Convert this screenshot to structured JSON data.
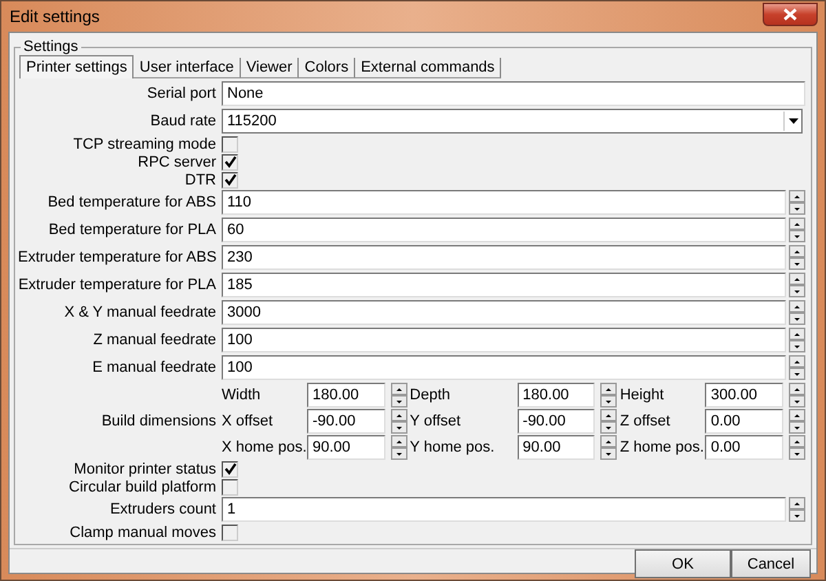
{
  "window": {
    "title": "Edit settings"
  },
  "group": {
    "title": "Settings"
  },
  "tabs": [
    {
      "label": "Printer settings",
      "selected": true
    },
    {
      "label": "User interface",
      "selected": false
    },
    {
      "label": "Viewer",
      "selected": false
    },
    {
      "label": "Colors",
      "selected": false
    },
    {
      "label": "External commands",
      "selected": false
    }
  ],
  "rows": [
    {
      "kind": "text",
      "label": "Serial port",
      "value": "None"
    },
    {
      "kind": "combo",
      "label": "Baud rate",
      "value": "115200"
    },
    {
      "kind": "checkbox",
      "label": "TCP streaming mode",
      "checked": false
    },
    {
      "kind": "checkbox",
      "label": "RPC server",
      "checked": true
    },
    {
      "kind": "checkbox",
      "label": "DTR",
      "checked": true
    },
    {
      "kind": "spin",
      "label": "Bed temperature for ABS",
      "value": "110"
    },
    {
      "kind": "spin",
      "label": "Bed temperature for PLA",
      "value": "60"
    },
    {
      "kind": "spin",
      "label": "Extruder temperature for ABS",
      "value": "230"
    },
    {
      "kind": "spin",
      "label": "Extruder temperature for PLA",
      "value": "185"
    },
    {
      "kind": "spin",
      "label": "X & Y manual feedrate",
      "value": "3000"
    },
    {
      "kind": "spin",
      "label": "Z manual feedrate",
      "value": "100"
    },
    {
      "kind": "spin",
      "label": "E manual feedrate",
      "value": "100"
    },
    {
      "kind": "dimensions",
      "label": "Build dimensions",
      "fields": [
        {
          "label": "Width",
          "value": "180.00"
        },
        {
          "label": "Depth",
          "value": "180.00"
        },
        {
          "label": "Height",
          "value": "300.00"
        },
        {
          "label": "X offset",
          "value": "-90.00"
        },
        {
          "label": "Y offset",
          "value": "-90.00"
        },
        {
          "label": "Z offset",
          "value": "0.00"
        },
        {
          "label": "X home pos.",
          "value": "90.00"
        },
        {
          "label": "Y home pos.",
          "value": "90.00"
        },
        {
          "label": "Z home pos.",
          "value": "0.00"
        }
      ]
    },
    {
      "kind": "checkbox",
      "label": "Monitor printer status",
      "checked": true
    },
    {
      "kind": "checkbox",
      "label": "Circular build platform",
      "checked": false
    },
    {
      "kind": "spin",
      "label": "Extruders count",
      "value": "1"
    },
    {
      "kind": "checkbox",
      "label": "Clamp manual moves",
      "checked": false
    }
  ],
  "buttons": [
    "OK",
    "Cancel"
  ]
}
